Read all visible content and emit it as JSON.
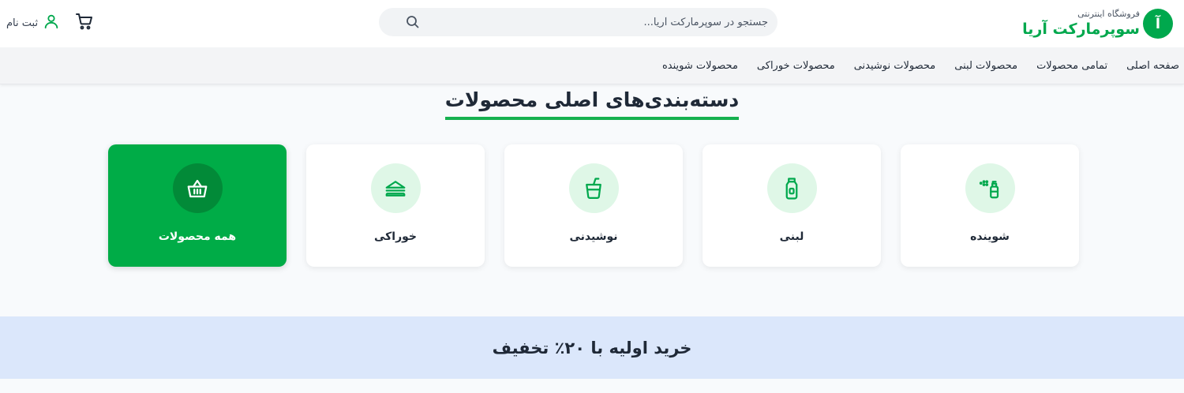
{
  "brand": {
    "logo_letter": "آ",
    "subtitle": "فروشگاه اینترنتی",
    "name": "سوپرمارکت آریا"
  },
  "search": {
    "placeholder": "جستجو در سوپرمارکت آریا...",
    "icon": "search-icon"
  },
  "account": {
    "signup_label": "ثبت نام",
    "icon": "user-icon"
  },
  "cart": {
    "icon": "cart-icon"
  },
  "nav": {
    "items": [
      {
        "label": "صفحه اصلی"
      },
      {
        "label": "تمامی محصولات"
      },
      {
        "label": "محصولات لبنی"
      },
      {
        "label": "محصولات نوشیدنی"
      },
      {
        "label": "محصولات خوراکی"
      },
      {
        "label": "محصولات شوینده"
      }
    ]
  },
  "categories": {
    "title": "دسته‌بندی‌های اصلی محصولات",
    "items": [
      {
        "label": "شوینده",
        "icon": "spray-bottle-icon",
        "active": false
      },
      {
        "label": "لبنی",
        "icon": "milk-bottle-icon",
        "active": false
      },
      {
        "label": "نوشیدنی",
        "icon": "drink-cup-icon",
        "active": false
      },
      {
        "label": "خوراکی",
        "icon": "sandwich-icon",
        "active": false
      },
      {
        "label": "همه محصولات",
        "icon": "basket-icon",
        "active": true
      }
    ]
  },
  "promo": {
    "text": "خرید اولیه با ۲۰٪ تخفیف"
  },
  "colors": {
    "brand_green": "#00a84d",
    "active_card": "#00ac47",
    "promo_bg": "#dbe7fb",
    "icon_circle": "#dff7e7"
  }
}
